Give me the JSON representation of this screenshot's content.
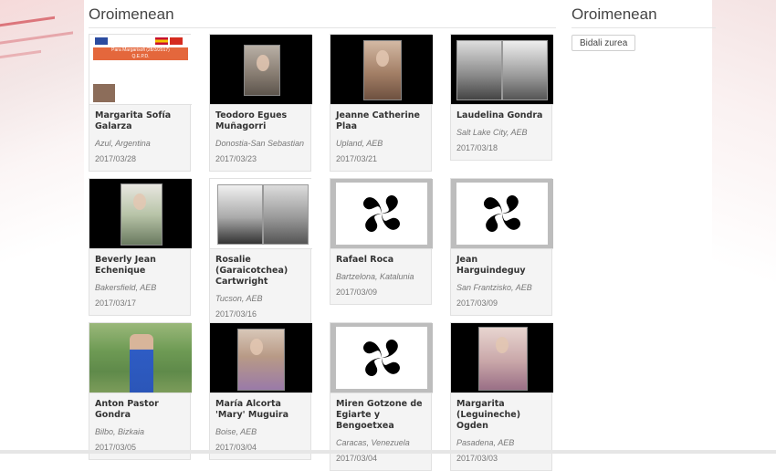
{
  "main": {
    "title": "Oroimenean",
    "cards": [
      {
        "name": "Margarita Sofía Galarza",
        "place": "Azul, Argentina",
        "date": "2017/03/28",
        "poster": {
          "banner_line1": "Para Margarisofi (28/3/2017)",
          "banner_line2": "Q.E.P.D."
        }
      },
      {
        "name": "Teodoro Egues Muñagorri",
        "place": "Donostia-San Sebastian",
        "date": "2017/03/23"
      },
      {
        "name": "Jeanne Catherine Plaa",
        "place": "Upland, AEB",
        "date": "2017/03/21"
      },
      {
        "name": "Laudelina Gondra",
        "place": "Salt Lake City, AEB",
        "date": "2017/03/18"
      },
      {
        "name": "Beverly Jean Echenique",
        "place": "Bakersfield, AEB",
        "date": "2017/03/17"
      },
      {
        "name": "Rosalie (Garaicotchea) Cartwright",
        "place": "Tucson, AEB",
        "date": "2017/03/16"
      },
      {
        "name": "Rafael Roca",
        "place": "Bartzelona, Katalunia",
        "date": "2017/03/09"
      },
      {
        "name": "Jean Harguindeguy",
        "place": "San Frantzisko, AEB",
        "date": "2017/03/09"
      },
      {
        "name": "Anton Pastor Gondra",
        "place": "Bilbo, Bizkaia",
        "date": "2017/03/05"
      },
      {
        "name": "María Alcorta 'Mary' Muguira",
        "place": "Boise, AEB",
        "date": "2017/03/04"
      },
      {
        "name": "Miren Gotzone de Egiarte y Bengoetxea",
        "place": "Caracas, Venezuela",
        "date": "2017/03/04"
      },
      {
        "name": "Margarita (Leguineche) Ogden",
        "place": "Pasadena, AEB",
        "date": "2017/03/03"
      }
    ]
  },
  "sidebar": {
    "title": "Oroimenean",
    "share_button": "Bidali zurea"
  },
  "colors": {
    "accent_red": "#c71f2a",
    "card_bg": "#f4f4f4",
    "poster_banner": "#e4673c"
  },
  "icons": {
    "lauburu": "lauburu-icon"
  }
}
